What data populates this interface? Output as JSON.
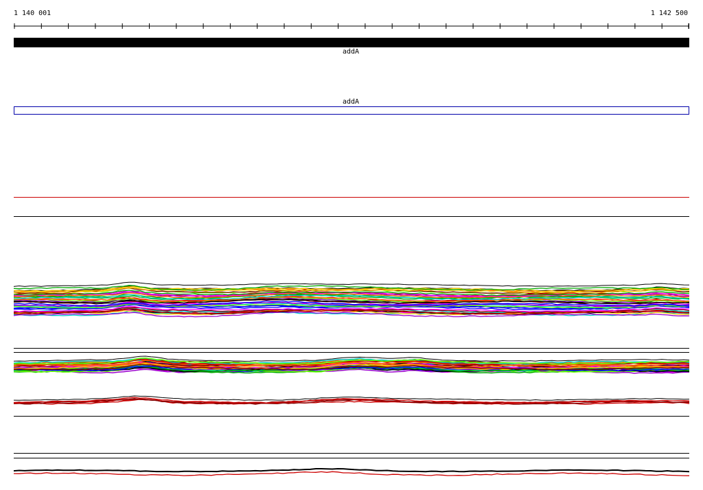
{
  "ruler": {
    "start_label": "1 140 001",
    "end_label": "1 142 500"
  },
  "annotation_tracks": [
    {
      "gene_name": "addA",
      "style": "solid-bar",
      "color": "#000000"
    },
    {
      "gene_name": "addA",
      "style": "outline-box",
      "color": "#0000aa"
    }
  ],
  "colors": {
    "ruler": "#000000",
    "separator": "#000000",
    "red_line": "#cc0000",
    "trace_palette": [
      "#000000",
      "#cc0000",
      "#ff00ff",
      "#9900cc",
      "#00cccc",
      "#00aa00",
      "#0000ff",
      "#ffcc00",
      "#ff6600",
      "#66ff00",
      "#800000"
    ]
  }
}
